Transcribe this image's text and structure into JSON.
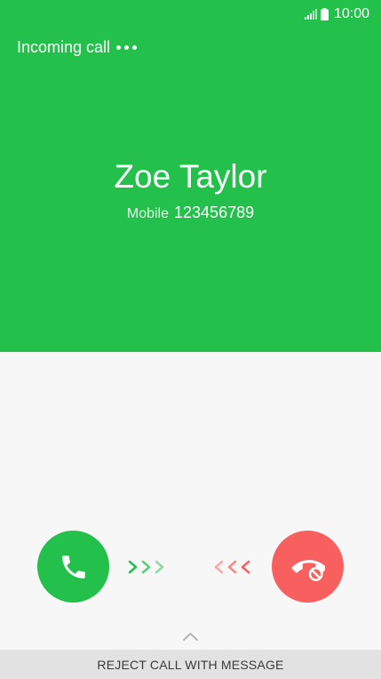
{
  "colors": {
    "top_background": "#23c04b",
    "bottom_background": "#f7f7f7",
    "answer": "#23c04b",
    "reject": "#f8605f",
    "bar": "#e2e2e2"
  },
  "status_bar": {
    "time": "10:00",
    "icons": [
      "signal-icon",
      "battery-icon"
    ]
  },
  "header": {
    "incoming_label": "Incoming call",
    "more_icon": "more-dots-icon"
  },
  "caller": {
    "name": "Zoe Taylor",
    "type": "Mobile",
    "number": "123456789"
  },
  "actions": {
    "answer_icon": "phone-icon",
    "reject_icon": "phone-reject-icon",
    "swipe_right_icon": "chevrons-right-icon",
    "swipe_left_icon": "chevrons-left-icon"
  },
  "reject_with_message": {
    "label": "REJECT CALL WITH MESSAGE",
    "icon": "chevron-up-icon"
  }
}
